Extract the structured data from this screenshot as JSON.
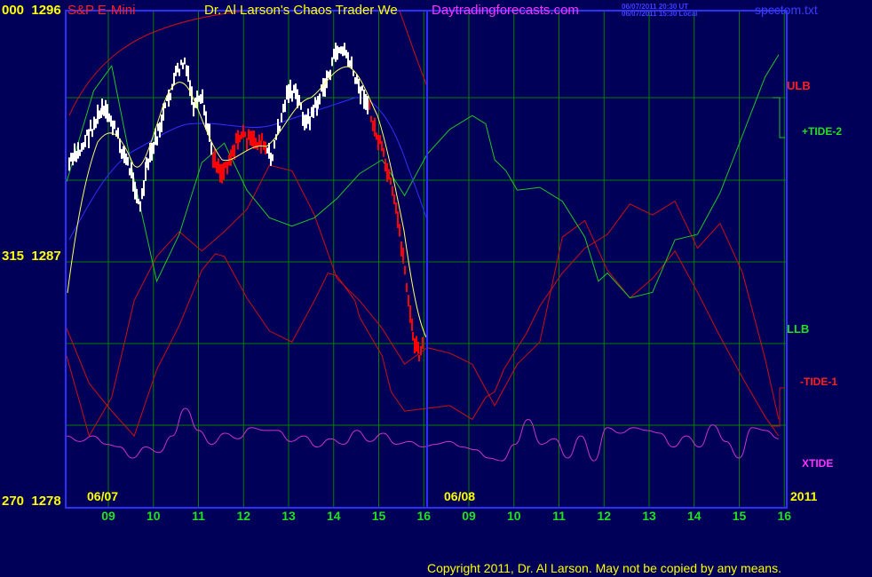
{
  "header": {
    "price_left": "000  1296",
    "symbol": "S&P E-Mini",
    "title_a": "Dr. Al Larson's Chaos Trader We",
    "title_b": "Daytradingforecasts.com",
    "timestamp_1": "06/07/2011 20:30 UT",
    "timestamp_2": "06/07/2011 15:30 Local",
    "file": "spcctom.txt"
  },
  "left_axis": {
    "mid": "315  1287",
    "bottom": "270  1278"
  },
  "right_labels": {
    "ulb": "ULB",
    "tide2": "+TIDE-2",
    "llb": "LLB",
    "tide1": "-TIDE-1",
    "xtide": "XTIDE"
  },
  "dates": {
    "d1": "06/07",
    "d2": "06/08",
    "year": "2011"
  },
  "footer": {
    "copyright": "Copyright 2011, Dr. Al Larson. May not be copied by any means."
  },
  "colors": {
    "background": "#000058",
    "grid": "#008000",
    "border": "#2e2eff",
    "ulb": "#cc1010",
    "tide2": "#22c622",
    "xtide": "#cc33cc",
    "bars_up": "#ffffff",
    "bars_down": "#ff0000",
    "yellow": "#ffff66",
    "blue": "#3030ff"
  },
  "chart_data": {
    "type": "line",
    "title": "Dr. Al Larson's Chaos Trader We",
    "symbol": "S&P E-Mini",
    "price_ticks": [
      1296,
      1287,
      1278
    ],
    "ylim": [
      1278,
      1296
    ],
    "x_tick_labels": [
      "09",
      "10",
      "11",
      "12",
      "13",
      "14",
      "15",
      "16",
      "09",
      "10",
      "11",
      "12",
      "13",
      "14",
      "15",
      "16"
    ],
    "series": [
      {
        "name": "ULB",
        "x": [
          0,
          0.5,
          1,
          1.5,
          2,
          2.5,
          3,
          3.3,
          3.5,
          4,
          4.5,
          5,
          5.5,
          5.8,
          6,
          6.4,
          6.5,
          7,
          7.2,
          7.5,
          8,
          8.5,
          9,
          9.3,
          9.5,
          9.7,
          10,
          10.2,
          10.5,
          11,
          11.5,
          12,
          12.5,
          13,
          13.5,
          14,
          14.5,
          15,
          15.5,
          15.8
        ],
        "values": [
          1284.5,
          1282.5,
          1281.5,
          1280.6,
          1283,
          1284.6,
          1286.6,
          1287.2,
          1287.1,
          1285.6,
          1284.4,
          1284,
          1285.5,
          1286.5,
          1286.4,
          1285.5,
          1284.9,
          1283.5,
          1282.2,
          1281.5,
          1281.6,
          1281.7,
          1281.2,
          1282,
          1282.2,
          1283,
          1283.8,
          1284.3,
          1285.3,
          1286.5,
          1287.4,
          1287.9,
          1289,
          1288.6,
          1289.1,
          1287.4,
          1288.3,
          1286.5,
          1283.4,
          1281.2
        ]
      },
      {
        "name": "+TIDE-2",
        "x": [
          0,
          0.6,
          1,
          1.5,
          2,
          2.5,
          3,
          3.5,
          4,
          4.5,
          5,
          5.5,
          6,
          6.5,
          7,
          7.5,
          8,
          8.5,
          9,
          9.3,
          9.5,
          9.75,
          10,
          10.5,
          11,
          11.5,
          11.8,
          12,
          12.5,
          13,
          13.5,
          14,
          14.5,
          15,
          15.5,
          15.8
        ],
        "values": [
          1289.8,
          1293.1,
          1294,
          1289.9,
          1286.2,
          1287.9,
          1290.5,
          1291.2,
          1289.5,
          1288.5,
          1288.2,
          1288.5,
          1289.2,
          1290.1,
          1290.6,
          1289.3,
          1290.8,
          1291.7,
          1292.2,
          1291.9,
          1290.6,
          1290.2,
          1289.5,
          1289.6,
          1289.1,
          1287.8,
          1286.2,
          1286.5,
          1285.6,
          1285.8,
          1287.7,
          1287.9,
          1289.4,
          1291.5,
          1293.6,
          1294.4
        ]
      },
      {
        "name": "LLB",
        "x": [
          0,
          0.5,
          1,
          1.5,
          2,
          2.5,
          3,
          3.5,
          4,
          4.5,
          5,
          5.5,
          6,
          6.5,
          7,
          7.5,
          8,
          8.5,
          9,
          9.5,
          10,
          10.5,
          11,
          11.5,
          12,
          12.5,
          13,
          13.5,
          14,
          14.5,
          15,
          15.5,
          15.8
        ],
        "values": [
          1283.5,
          1280.6,
          1282,
          1285.5,
          1287.1,
          1288,
          1287.3,
          1288,
          1288.8,
          1290.4,
          1290.2,
          1288.6,
          1286.3,
          1285.5,
          1284.5,
          1283.2,
          1283.8,
          1283.6,
          1283.2,
          1281.7,
          1283.2,
          1284,
          1287.8,
          1288.4,
          1286.6,
          1285.6,
          1286.3,
          1287.3,
          1285.8,
          1284.2,
          1282.7,
          1281.3,
          1280.6
        ]
      },
      {
        "name": "XTIDE",
        "x_range": [
          0,
          15.8
        ],
        "values": [
          1280.6,
          1280.4,
          1280.6,
          1280.3,
          1280.2,
          1279.8,
          1280.2,
          1280.0,
          1280.6,
          1281.6,
          1280.8,
          1280.3,
          1280.7,
          1280.5,
          1280.9,
          1280.8,
          1280.8,
          1280.4,
          1280.6,
          1280.2,
          1280.5,
          1280.3,
          1280.8,
          1280.4,
          1280.7,
          1280.3,
          1280.4,
          1280.2,
          1280.3,
          1280.4,
          1280.2,
          1280.1,
          1279.8,
          1279.7,
          1280.3,
          1281.2,
          1280.3,
          1280.5,
          1279.8,
          1280.6,
          1279.7,
          1280.9,
          1280.7,
          1280.9,
          1280.8,
          1280.7,
          1280.2,
          1280.6,
          1280.2,
          1281.0,
          1280.4,
          1279.8,
          1280.9,
          1280.8,
          1280.5
        ]
      }
    ]
  }
}
